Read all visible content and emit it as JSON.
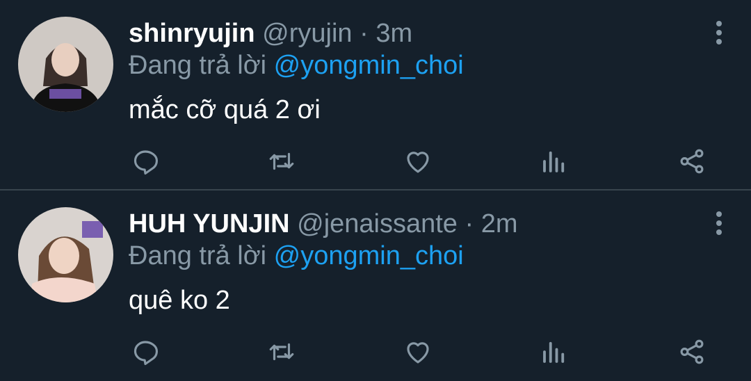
{
  "tweets": [
    {
      "display_name": "shinryujin",
      "handle": "@ryujin",
      "time": "3m",
      "reply_prefix": "Đang trả lời",
      "reply_to": "@yongmin_choi",
      "text": "mắc cỡ quá 2 ơi",
      "avatar_icon": "avatar-photo"
    },
    {
      "display_name": "HUH YUNJIN",
      "handle": "@jenaissante",
      "time": "2m",
      "reply_prefix": "Đang trả lời",
      "reply_to": "@yongmin_choi",
      "text": "quê ko 2",
      "avatar_icon": "avatar-photo"
    }
  ],
  "separator": "·",
  "actions": [
    "reply-icon",
    "retweet-icon",
    "like-icon",
    "analytics-icon",
    "share-icon"
  ],
  "colors": {
    "background": "#15202b",
    "divider": "#38444d",
    "muted_text": "#8899a6",
    "mention": "#1da1f2",
    "primary_text": "#ffffff"
  }
}
